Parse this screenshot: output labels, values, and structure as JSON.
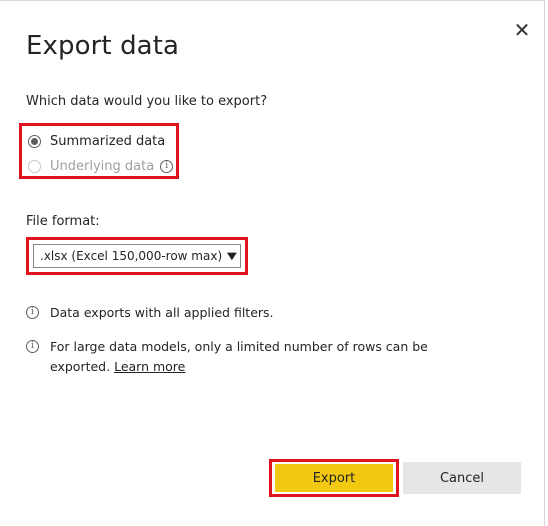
{
  "dialog": {
    "title": "Export data",
    "close_glyph": "✕"
  },
  "question": "Which data would you like to export?",
  "options": [
    {
      "label": "Summarized data",
      "checked": true,
      "disabled": false
    },
    {
      "label": "Underlying data",
      "checked": false,
      "disabled": true,
      "info_icon": "info-icon"
    }
  ],
  "file_format": {
    "label": "File format:",
    "selected": ".xlsx (Excel 150,000-row max)"
  },
  "notes": {
    "filters": "Data exports with all applied filters.",
    "large_models": "For large data models, only a limited number of rows can be exported.",
    "learn_more": "Learn more"
  },
  "buttons": {
    "export": "Export",
    "cancel": "Cancel"
  },
  "colors": {
    "accent_yellow": "#f2c811",
    "highlight_red": "#e0141e",
    "cancel_gray": "#e6e6e6"
  },
  "icons": {
    "info": "ⓘ"
  }
}
